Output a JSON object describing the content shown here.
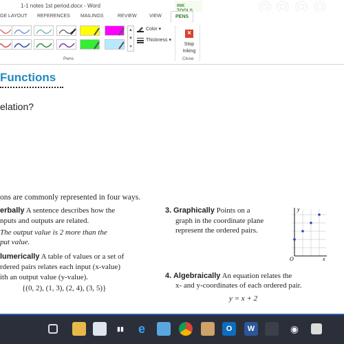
{
  "window": {
    "title": "1-1 notes 1st period.docx - Word",
    "context_tab_group": "INK TOOLS"
  },
  "ribbon_tabs": {
    "page_layout": "GE LAYOUT",
    "references": "REFERENCES",
    "mailings": "MAILINGS",
    "review": "REVIEW",
    "view": "VIEW",
    "pens": "PENS"
  },
  "ribbon": {
    "color_label": "Color",
    "thickness_label": "Thickness",
    "stop_inking_line1": "Stop",
    "stop_inking_line2": "Inking",
    "pens_group_label": "Pens",
    "close_group_label": "Close"
  },
  "document": {
    "heading": "Functions",
    "question": "elation?",
    "intro": "ons are commonly represented in four ways.",
    "item1": {
      "head": "erbally",
      "line1": " A sentence describes how the",
      "line2": "nputs and outputs are related.",
      "line3": "The output value is 2 more than the",
      "line4": "put value."
    },
    "item2": {
      "head": "lumerically",
      "line1": " A table of values or a set of",
      "line2": "rdered pairs relates each input (x-value)",
      "line3": "ith an output value (y-value).",
      "line4": "{(0, 2), (1, 3), (2, 4), (3, 5)}"
    },
    "item3": {
      "number": "3.",
      "head": "Graphically",
      "line1": " Points on a",
      "line2": "graph in the coordinate plane",
      "line3": "represent the ordered pairs."
    },
    "item4": {
      "number": "4.",
      "head": "Algebraically",
      "line1": " An equation relates the",
      "line2": "x- and y-coordinates of each ordered pair.",
      "equation": "y = x + 2"
    },
    "graph": {
      "y_label": "y",
      "x_label": "x",
      "origin_label": "O",
      "point_color": "#2a4aa8"
    }
  },
  "colors": {
    "heading": "#1f8ac4",
    "pens_tab": "#2b7a2b",
    "stop_inking": "#d9412b",
    "taskbar": "#2a2f3a"
  },
  "taskbar_icons": [
    "start-icon",
    "task-view-icon",
    "file-explorer-icon",
    "store-icon",
    "edge-icon",
    "chrome-icon",
    "photos-icon",
    "outlook-icon",
    "word-icon",
    "snipping-icon",
    "settings-icon"
  ]
}
